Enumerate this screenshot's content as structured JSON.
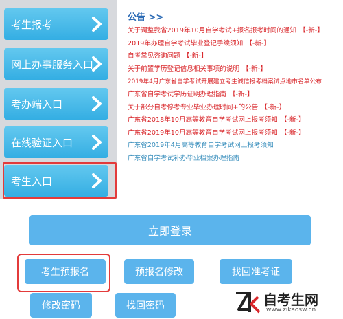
{
  "nav": {
    "items": [
      {
        "label": "考生报考"
      },
      {
        "label": "网上办事服务入口"
      },
      {
        "label": "考办端入口"
      },
      {
        "label": "在线验证入口"
      },
      {
        "label": "考生入口"
      }
    ]
  },
  "notice": {
    "title": "公告 >>",
    "items": [
      {
        "text": "关于调整我省2019年10月自学考试+报名报考时间的通知",
        "tag": "【-新-】",
        "color": "red"
      },
      {
        "text": "2019年办理自学考试毕业登记手续须知",
        "tag": "【-新-】",
        "color": "red"
      },
      {
        "text": "自考常见咨询问题",
        "tag": "【-新-】",
        "color": "red"
      },
      {
        "text": "关于前置学历登记信息相关事项的说明",
        "tag": "【-新-】",
        "color": "red"
      },
      {
        "text": "2019年4月广东省自学考试开展建立考生诚信报考档案试点地市名单公布",
        "tag": "",
        "color": "red"
      },
      {
        "text": "广东省自学考试学历证明办理指南",
        "tag": "【-新-】",
        "color": "red"
      },
      {
        "text": "关于部分自考停考专业毕业办理时间+的公告",
        "tag": "【-新-】",
        "color": "red"
      },
      {
        "text": "广东省2018年10月高等教育自学考试网上报考须知",
        "tag": "【-新-】",
        "color": "red"
      },
      {
        "text": "广东省2019年10月高等教育自学考试网上报考须知",
        "tag": "【-新-】",
        "color": "red"
      },
      {
        "text": "广东省2019年4月高等教育自学考试网上报考须知",
        "tag": "",
        "color": "blue"
      },
      {
        "text": "广东省自学考试补办毕业档案办理指南",
        "tag": "",
        "color": "blue"
      }
    ]
  },
  "actions": {
    "login": "立即登录",
    "prereg": "考生预报名",
    "modify": "预报名修改",
    "find_id": "找回准考证",
    "change_pw": "修改密码",
    "find_pw": "找回密码"
  },
  "watermark": {
    "logo_text": "Zk",
    "name": "自考生网",
    "url": "www.zikaosw.cn"
  },
  "colors": {
    "nav_button": "#4bbbea",
    "action_button": "#5bb4ec",
    "highlight": "#e33b3b",
    "notice_red": "#d9272b",
    "notice_blue": "#3a8fbd",
    "title_blue": "#2c6bb5"
  }
}
